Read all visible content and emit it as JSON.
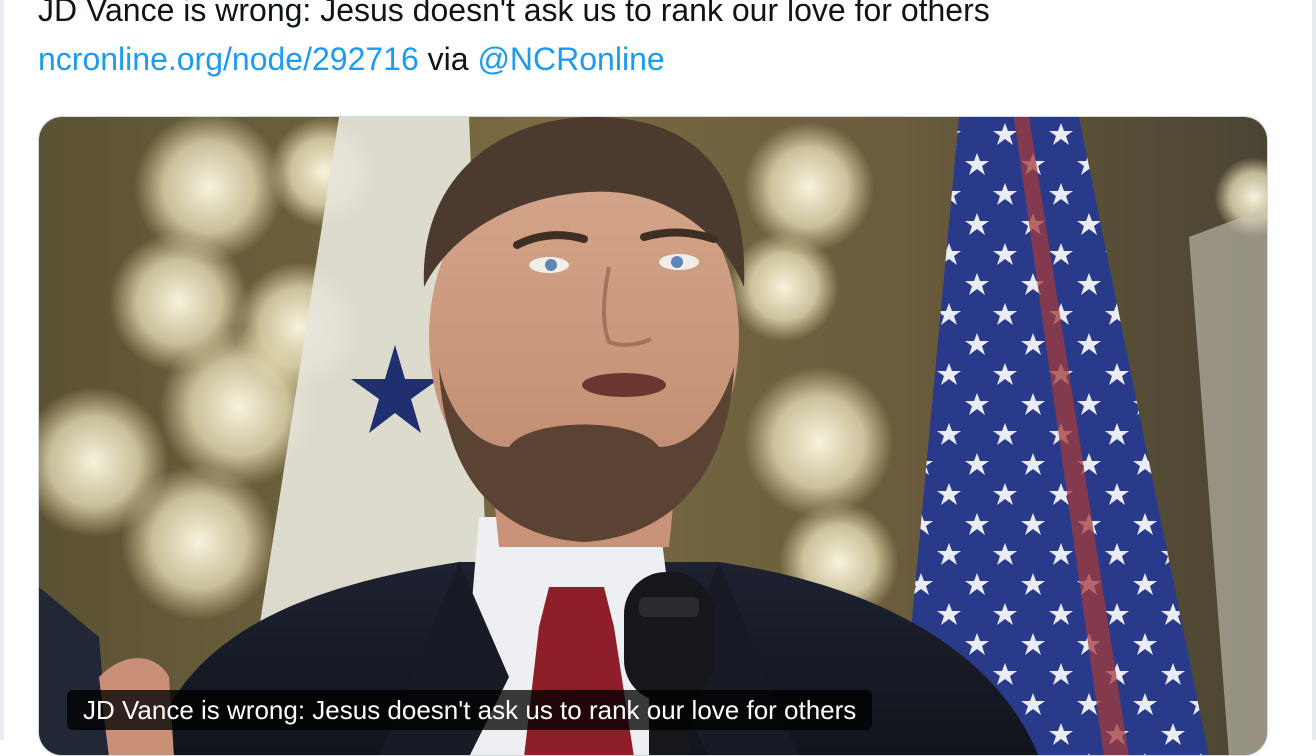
{
  "tweet": {
    "headline": "JD Vance is wrong: Jesus doesn't ask us to rank our love for others",
    "link_text": "ncronline.org/node/292716",
    "via_text": " via ",
    "mention": "@NCRonline"
  },
  "card": {
    "caption": "JD Vance is wrong: Jesus doesn't ask us to rank our love for others"
  }
}
